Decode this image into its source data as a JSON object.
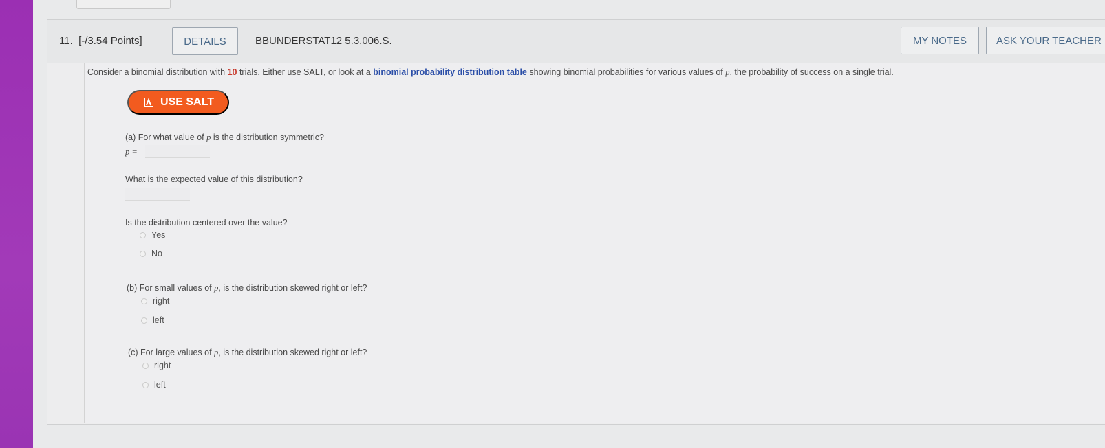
{
  "question": {
    "number": "11.",
    "points": "[-/3.54 Points]",
    "details_label": "DETAILS",
    "code": "BBUNDERSTAT12 5.3.006.S.",
    "my_notes_label": "MY NOTES",
    "ask_teacher_label": "ASK YOUR TEACHER"
  },
  "prompt": {
    "part1": "Consider a binomial distribution with ",
    "trials": "10",
    "part2": " trials. Either use SALT, or look at a ",
    "link": "binomial probability distribution table",
    "part3": " showing binomial probabilities for various values of ",
    "var": "p",
    "part4": ", the probability of success on a single trial."
  },
  "salt_label": "USE SALT",
  "part_a": {
    "question_pre": "(a) For what value of ",
    "question_var": "p",
    "question_post": " is the distribution symmetric?",
    "p_label": "p =",
    "expected_question": "What is the expected value of this distribution?",
    "centered_question": "Is the distribution centered over the value?",
    "options": [
      "Yes",
      "No"
    ]
  },
  "part_b": {
    "question_pre": "(b) For small values of ",
    "question_var": "p",
    "question_post": ", is the distribution skewed right or left?",
    "options": [
      "right",
      "left"
    ]
  },
  "part_c": {
    "question_pre": "(c) For large values of ",
    "question_var": "p",
    "question_post": ", is the distribution skewed right or left?",
    "options": [
      "right",
      "left"
    ]
  },
  "colors": {
    "accent_purple": "#9b2fb3",
    "salt_orange": "#f25b1f",
    "link_blue": "#2c4fa8",
    "highlight_red": "#c83a2e"
  }
}
